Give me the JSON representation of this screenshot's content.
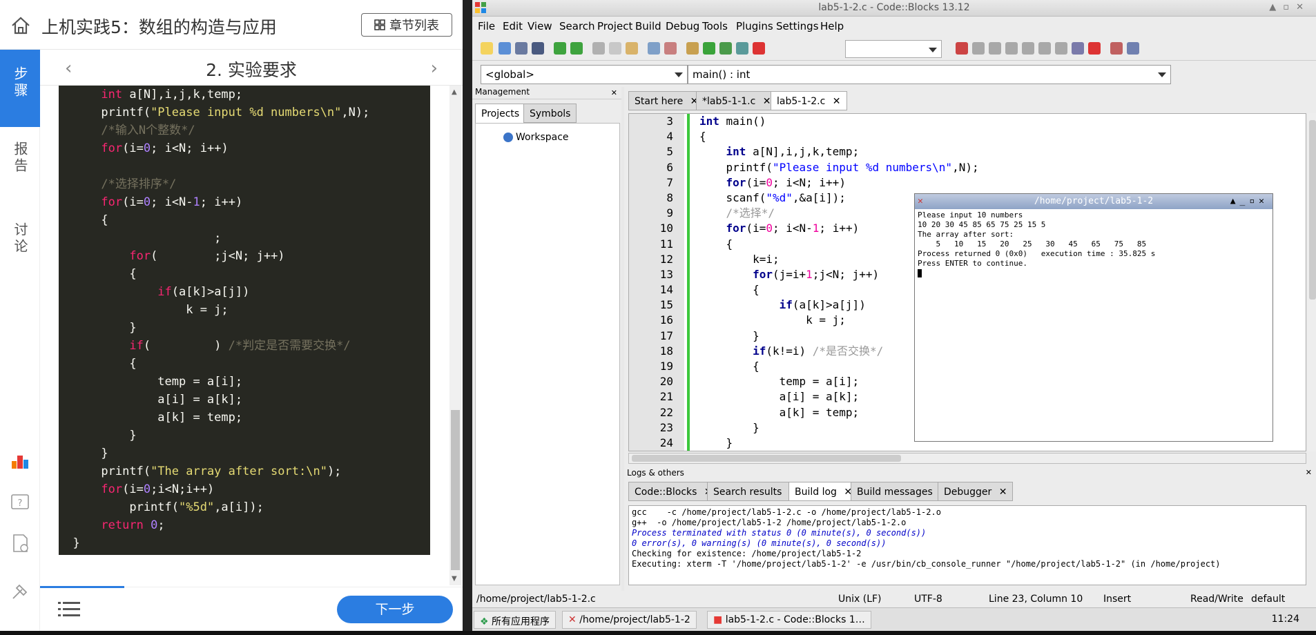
{
  "course": {
    "title": "上机实践5：数组的构造与应用",
    "chapters_btn": "章节列表",
    "section_title": "2. 实验要求",
    "side_tabs": [
      "步骤",
      "报告",
      "讨论"
    ],
    "next_btn": "下一步"
  },
  "left_code": [
    "    int a[N],i,j,k,temp;",
    "    printf(\"Please input %d numbers\\n\",N);",
    "    /*输入N个整数*/",
    "    for(i=0; i<N; i++)",
    "",
    "    /*选择排序*/",
    "    for(i=0; i<N-1; i++)",
    "    {",
    "                    ;",
    "        for(        ;j<N; j++)",
    "        {",
    "            if(a[k]>a[j])",
    "                k = j;",
    "        }",
    "        if(         ) /*判定是否需要交换*/",
    "        {",
    "            temp = a[i];",
    "            a[i] = a[k];",
    "            a[k] = temp;",
    "        }",
    "    }",
    "    printf(\"The array after sort:\\n\");",
    "    for(i=0;i<N;i++)",
    "        printf(\"%5d\",a[i]);",
    "    return 0;",
    "}"
  ],
  "ide": {
    "window_title": "lab5-1-2.c - Code::Blocks 13.12",
    "menu": [
      "File",
      "Edit",
      "View",
      "Search",
      "Project",
      "Build",
      "Debug",
      "Tools",
      "Plugins",
      "Settings",
      "Help"
    ],
    "scope_global": "<global>",
    "scope_func": "main() : int",
    "management_label": "Management",
    "mgmt_tabs": [
      "Projects",
      "Symbols"
    ],
    "workspace": "Workspace",
    "editor_tabs": [
      "Start here",
      "*lab5-1-1.c",
      "lab5-1-2.c"
    ],
    "line_numbers": [
      "3",
      "4",
      "5",
      "6",
      "7",
      "8",
      "9",
      "10",
      "11",
      "12",
      "13",
      "14",
      "15",
      "16",
      "17",
      "18",
      "19",
      "20",
      "21",
      "22",
      "23",
      "24"
    ],
    "code": [
      "int main()",
      "{",
      "    int a[N],i,j,k,temp;",
      "    printf(\"Please input %d numbers\\n\",N);",
      "    for(i=0; i<N; i++)",
      "    scanf(\"%d\",&a[i]);",
      "    /*选择*/",
      "    for(i=0; i<N-1; i++)",
      "    {",
      "        k=i;",
      "        for(j=i+1;j<N; j++)",
      "        {",
      "            if(a[k]>a[j])",
      "                k = j;",
      "        }",
      "        if(k!=i) /*是否交换*/",
      "        {",
      "            temp = a[i];",
      "            a[i] = a[k];",
      "            a[k] = temp;",
      "        }",
      "    }"
    ],
    "terminal": {
      "title": "/home/project/lab5-1-2",
      "text": "Please input 10 numbers\n10 20 30 45 85 65 75 25 15 5\nThe array after sort:\n    5   10   15   20   25   30   45   65   75   85\nProcess returned 0 (0x0)   execution time : 35.825 s\nPress ENTER to continue."
    },
    "logs_label": "Logs & others",
    "log_tabs": [
      "Code::Blocks",
      "Search results",
      "Build log",
      "Build messages",
      "Debugger"
    ],
    "log_lines": [
      "gcc    -c /home/project/lab5-1-2.c -o /home/project/lab5-1-2.o",
      "g++  -o /home/project/lab5-1-2 /home/project/lab5-1-2.o",
      "Process terminated with status 0 (0 minute(s), 0 second(s))",
      "0 error(s), 0 warning(s) (0 minute(s), 0 second(s))",
      "",
      "Checking for existence: /home/project/lab5-1-2",
      "Executing: xterm -T '/home/project/lab5-1-2' -e /usr/bin/cb_console_runner \"/home/project/lab5-1-2\" (in /home/project)"
    ],
    "status": {
      "file": "/home/project/lab5-1-2.c",
      "eol": "Unix (LF)",
      "enc": "UTF-8",
      "pos": "Line 23, Column 10",
      "mode": "Insert",
      "rw": "Read/Write",
      "deflt": "default"
    },
    "taskbar": {
      "apps": "所有应用程序",
      "term": "/home/project/lab5-1-2",
      "cb": "lab5-1-2.c - Code::Blocks 1…",
      "clock": "11:24"
    }
  }
}
